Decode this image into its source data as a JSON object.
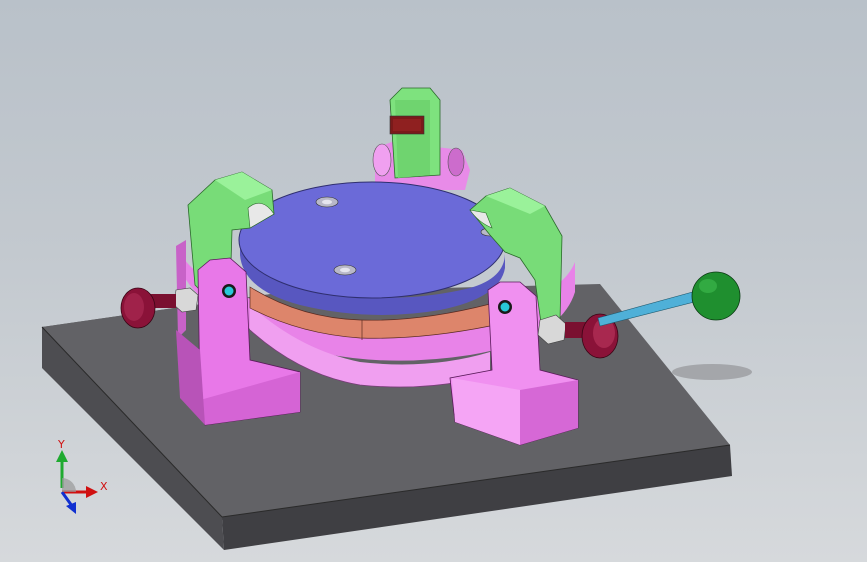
{
  "viewport": {
    "background_top": "#b9c1c9",
    "background_bottom": "#d6d9dc"
  },
  "model": {
    "base_plate_color": "#5a5a5e",
    "rotary_table_color": "#6b6ad6",
    "ring_color": "#ee88ee",
    "friction_band_color": "#d8806a",
    "clamp_arm_color": "#7be07b",
    "support_block_color": "#e770e7",
    "handle_rod_color": "#4fb0d8",
    "handle_knob_color": "#1f8f2f",
    "knob_color": "#8a1238"
  },
  "triad": {
    "x_label": "X",
    "y_label": "Y",
    "x_color": "#d01010",
    "y_color": "#1faa30",
    "z_color": "#1030d0"
  }
}
